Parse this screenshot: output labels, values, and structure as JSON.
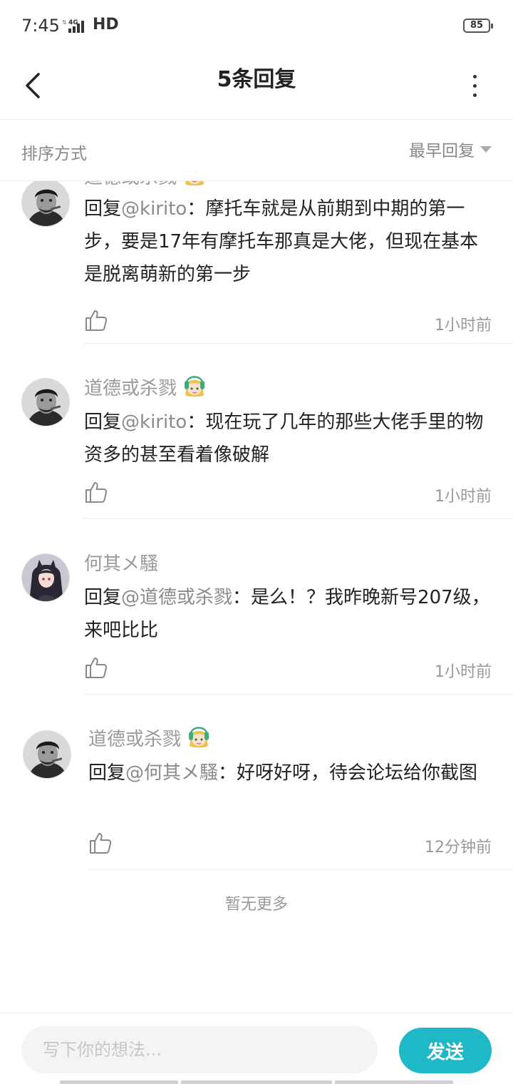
{
  "status_bar": {
    "time": "7:45",
    "network": "4G",
    "hd": "HD",
    "battery": "85"
  },
  "header": {
    "title": "5条回复",
    "back_icon": "chevron-left-icon",
    "more_icon": "more-vertical-icon"
  },
  "sort": {
    "label": "排序方式",
    "value": "最早回复"
  },
  "comments": [
    {
      "username": "道德或杀戮",
      "avatar": "avatar-bw-man",
      "badge": "anime-girl-badge",
      "reply_prefix": "回复",
      "mention": "@kirito",
      "content": "：摩托车就是从前期到中期的第一步，要是17年有摩托车那真是大佬，但现在基本是脱离萌新的第一步",
      "time": "1小时前"
    },
    {
      "username": "道德或杀戮",
      "avatar": "avatar-bw-man",
      "badge": "anime-girl-badge",
      "reply_prefix": "回复",
      "mention": "@kirito",
      "content": "：现在玩了几年的那些大佬手里的物资多的甚至看着像破解",
      "time": "1小时前"
    },
    {
      "username": "何其メ騷",
      "avatar": "avatar-anime-girl",
      "badge": "",
      "reply_prefix": "回复",
      "mention": "@道德或杀戮",
      "content": "：是么！？我昨晚新号207级，来吧比比",
      "time": "1小时前"
    },
    {
      "username": "道德或杀戮",
      "avatar": "avatar-bw-man",
      "badge": "anime-girl-badge",
      "reply_prefix": "回复",
      "mention": "@何其メ騷",
      "content": "：好呀好呀，待会论坛给你截图",
      "time": "12分钟前"
    }
  ],
  "footer_text": "暂无更多",
  "composer": {
    "placeholder": "写下你的想法...",
    "send_label": "发送"
  },
  "colors": {
    "accent": "#1eb8c6",
    "muted_text": "#999999",
    "divider": "#ececec"
  }
}
